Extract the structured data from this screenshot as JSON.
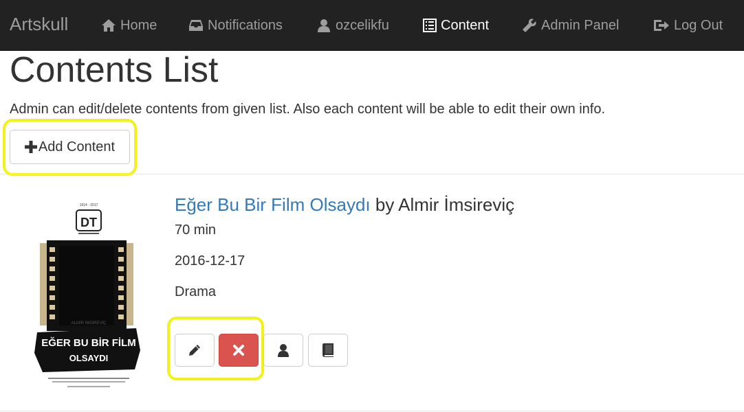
{
  "navbar": {
    "brand": "Artskull",
    "items": [
      {
        "label": "Home",
        "icon": "home-icon"
      },
      {
        "label": "Notifications",
        "icon": "inbox-icon"
      },
      {
        "label": "ozcelikfu",
        "icon": "user-icon"
      },
      {
        "label": "Content",
        "icon": "list-icon",
        "active": true
      },
      {
        "label": "Admin Panel",
        "icon": "wrench-icon"
      },
      {
        "label": "Log Out",
        "icon": "logout-icon"
      }
    ]
  },
  "page": {
    "title": "Contents List",
    "description": "Admin can edit/delete contents from given list. Also each content will be able to edit their own info.",
    "add_button_label": "Add Content"
  },
  "content": {
    "title": "Eğer Bu Bir Film Olsaydı",
    "by_text": " by Almir İmsireviç",
    "duration": "70 min",
    "date": "2016-12-17",
    "genre": "Drama",
    "actions": [
      "pencil-icon",
      "remove-icon",
      "user-icon",
      "book-icon"
    ]
  },
  "poster": {
    "top_text": "DT",
    "author": "ALMİR İMSİREVİÇ",
    "title_line1": "EĞER BU BİR FİLM",
    "title_line2": "OLSAYDI"
  },
  "colors": {
    "navbar_bg": "#222222",
    "link": "#337ab7",
    "danger": "#d9534f",
    "highlight": "#f2f21a"
  }
}
